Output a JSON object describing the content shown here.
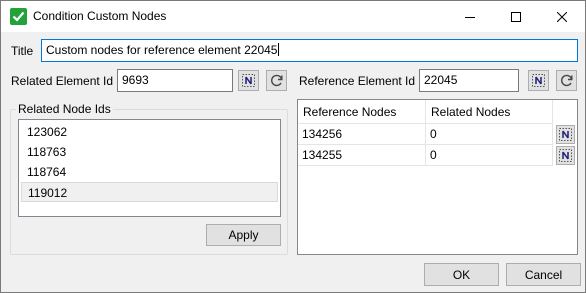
{
  "window": {
    "title": "Condition Custom Nodes",
    "icons": {
      "app": "checkmark-icon",
      "minimize": "minimize-icon",
      "maximize": "maximize-icon",
      "close": "close-icon"
    }
  },
  "form": {
    "title_label": "Title",
    "title_value": "Custom nodes for reference element 22045",
    "related_element_label": "Related Element Id",
    "related_element_value": "9693",
    "reference_element_label": "Reference Element Id",
    "reference_element_value": "22045"
  },
  "related_nodes": {
    "group_label": "Related Node Ids",
    "items": [
      "123062",
      "118763",
      "118764",
      "119012"
    ],
    "selected_index": 3,
    "apply_label": "Apply"
  },
  "grid": {
    "columns": [
      "Reference Nodes",
      "Related Nodes"
    ],
    "rows": [
      {
        "reference": "134256",
        "related": "0"
      },
      {
        "reference": "134255",
        "related": "0"
      }
    ]
  },
  "footer": {
    "ok_label": "OK",
    "cancel_label": "Cancel"
  },
  "colors": {
    "accent": "#0078d7",
    "app_icon": "#22a33a",
    "pick_icon": "#1f1f7a"
  }
}
